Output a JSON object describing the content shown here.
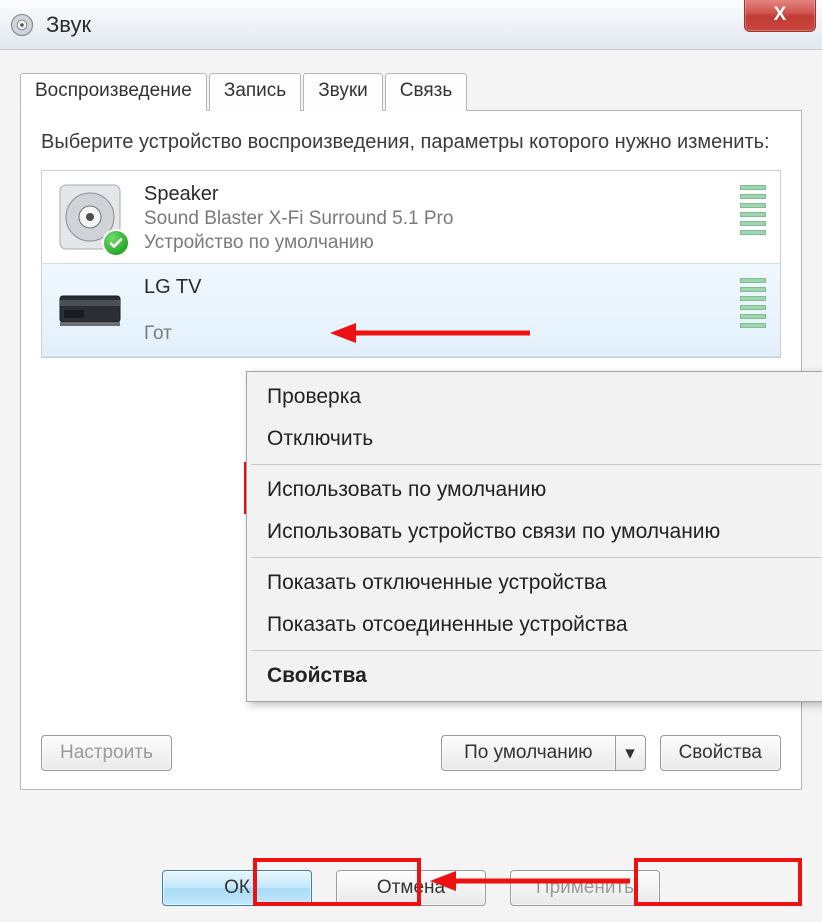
{
  "window": {
    "title": "Звук",
    "close_glyph": "X"
  },
  "tabs": [
    {
      "label": "Воспроизведение",
      "active": true
    },
    {
      "label": "Запись"
    },
    {
      "label": "Звуки"
    },
    {
      "label": "Связь"
    }
  ],
  "instruction": "Выберите устройство воспроизведения, параметры которого нужно изменить:",
  "devices": [
    {
      "name": "Speaker",
      "sub": "Sound Blaster X-Fi Surround 5.1 Pro",
      "status": "Устройство по умолчанию",
      "default": true
    },
    {
      "name": "LG TV",
      "sub": "",
      "status": "Гот",
      "selected": true
    }
  ],
  "context_menu": {
    "items": [
      {
        "label": "Проверка"
      },
      {
        "label": "Отключить"
      },
      {
        "sep": true
      },
      {
        "label": "Использовать по умолчанию",
        "highlight": true
      },
      {
        "label": "Использовать устройство связи по умолчанию"
      },
      {
        "sep": true
      },
      {
        "label": "Показать отключенные устройства"
      },
      {
        "label": "Показать отсоединенные устройства"
      },
      {
        "sep": true
      },
      {
        "label": "Свойства",
        "bold": true
      }
    ]
  },
  "panel_buttons": {
    "configure": "Настроить",
    "default": "По умолчанию",
    "properties": "Свойства"
  },
  "dialog_buttons": {
    "ok": "ОК",
    "cancel": "Отмена",
    "apply": "Применить"
  }
}
